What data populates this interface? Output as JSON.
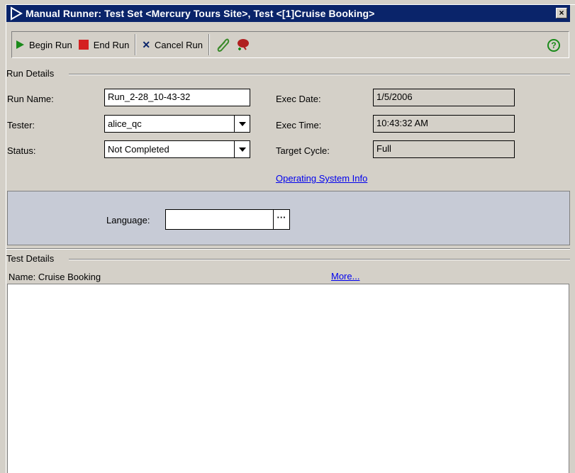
{
  "window": {
    "title": "Manual Runner: Test Set <Mercury Tours Site>, Test <[1]Cruise Booking>",
    "close_glyph": "×"
  },
  "toolbar": {
    "begin_run_label": "Begin Run",
    "end_run_label": "End Run",
    "cancel_run_label": "Cancel Run",
    "cancel_glyph": "✕",
    "help_glyph": "?"
  },
  "run_details": {
    "group_title": "Run Details",
    "run_name_label": "Run Name:",
    "run_name_value": "Run_2-28_10-43-32",
    "tester_label": "Tester:",
    "tester_value": "alice_qc",
    "status_label": "Status:",
    "status_value": "Not Completed",
    "exec_date_label": "Exec Date:",
    "exec_date_value": "1/5/2006",
    "exec_time_label": "Exec Time:",
    "exec_time_value": "10:43:32 AM",
    "target_cycle_label": "Target Cycle:",
    "target_cycle_value": "Full",
    "os_info_link": "Operating System Info",
    "language_label": "Language:",
    "language_value": "",
    "ellipsis_label": "···"
  },
  "test_details": {
    "group_title": "Test Details",
    "name_text": "Name: Cruise Booking",
    "more_link": "More..."
  },
  "colors": {
    "title_bar": "#0a246a",
    "window_bg": "#d4d0c8",
    "begin_icon": "#1a8a1a",
    "end_icon": "#d42020",
    "link": "#0000ee"
  }
}
